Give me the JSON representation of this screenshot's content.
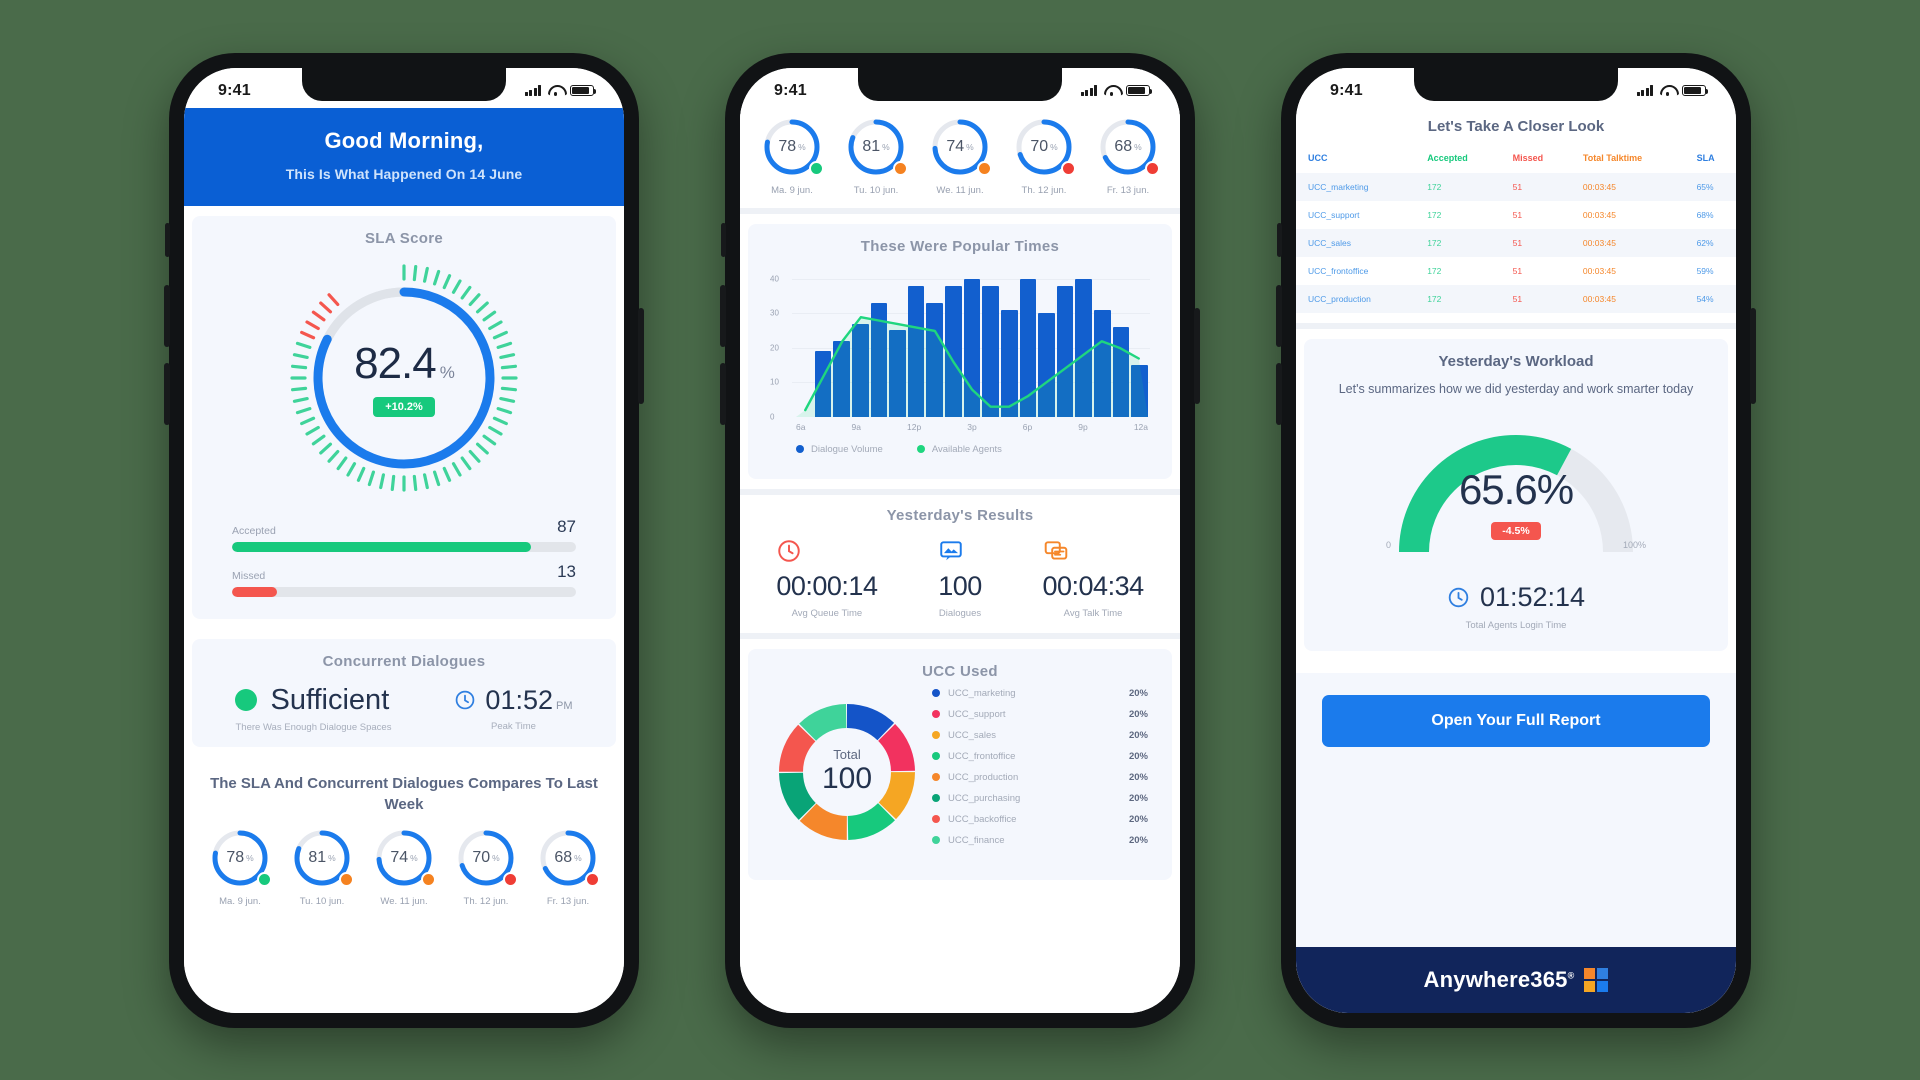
{
  "phone1": {
    "status": {
      "time": "9:41"
    },
    "hero": {
      "title": "Good Morning,",
      "subtitle": "This Is What Happened On 14 June"
    },
    "sla": {
      "title": "SLA Score",
      "value": "82.4",
      "unit": "%",
      "delta": "+10.2%",
      "percent": 82.4
    },
    "bars": [
      {
        "label": "Accepted",
        "value": "87",
        "percent": 87,
        "color": "#17c97d"
      },
      {
        "label": "Missed",
        "value": "13",
        "percent": 13,
        "color": "#f4564e"
      }
    ],
    "concurrent": {
      "title": "Concurrent Dialogues",
      "status": "Sufficient",
      "status_caption": "There Was Enough Dialogue Spaces",
      "peak_time": "01:52",
      "peak_meridiem": "PM",
      "peak_caption": "Peak Time"
    },
    "compare_heading": "The SLA And Concurrent Dialogues Compares To Last Week",
    "days": [
      {
        "value": "78",
        "unit": "%",
        "percent": 78,
        "badge": "#17c97d",
        "label": "Ma. 9 jun."
      },
      {
        "value": "81",
        "unit": "%",
        "percent": 81,
        "badge": "#f58220",
        "label": "Tu. 10 jun."
      },
      {
        "value": "74",
        "unit": "%",
        "percent": 74,
        "badge": "#f58220",
        "label": "We. 11 jun."
      },
      {
        "value": "70",
        "unit": "%",
        "percent": 70,
        "badge": "#ef3d35",
        "label": "Th. 12 jun."
      },
      {
        "value": "68",
        "unit": "%",
        "percent": 68,
        "badge": "#ef3d35",
        "label": "Fr. 13 jun."
      }
    ]
  },
  "phone2": {
    "status": {
      "time": "9:41"
    },
    "days": [
      {
        "value": "78",
        "unit": "%",
        "percent": 78,
        "badge": "#17c97d",
        "label": "Ma. 9 jun."
      },
      {
        "value": "81",
        "unit": "%",
        "percent": 81,
        "badge": "#f58220",
        "label": "Tu. 10 jun."
      },
      {
        "value": "74",
        "unit": "%",
        "percent": 74,
        "badge": "#f58220",
        "label": "We. 11 jun."
      },
      {
        "value": "70",
        "unit": "%",
        "percent": 70,
        "badge": "#ef3d35",
        "label": "Th. 12 jun."
      },
      {
        "value": "68",
        "unit": "%",
        "percent": 68,
        "badge": "#ef3d35",
        "label": "Fr. 13 jun."
      }
    ],
    "popular": {
      "title": "These Were Popular Times"
    },
    "results": {
      "title": "Yesterday's Results",
      "items": [
        {
          "icon": "clock-icon",
          "value": "00:00:14",
          "caption": "Avg Queue Time",
          "color": "#f4564e"
        },
        {
          "icon": "dialogue-icon",
          "value": "100",
          "caption": "Dialogues",
          "color": "#1b7bec"
        },
        {
          "icon": "chat-icon",
          "value": "00:04:34",
          "caption": "Avg Talk Time",
          "color": "#f5872b"
        }
      ]
    },
    "ucc": {
      "title": "UCC Used",
      "total_label": "Total",
      "total_value": "100",
      "items": [
        {
          "name": "UCC_marketing",
          "pct": "20%",
          "color": "#1454c8"
        },
        {
          "name": "UCC_support",
          "pct": "20%",
          "color": "#f2325f"
        },
        {
          "name": "UCC_sales",
          "pct": "20%",
          "color": "#f5a623"
        },
        {
          "name": "UCC_frontoffice",
          "pct": "20%",
          "color": "#17c97d"
        },
        {
          "name": "UCC_production",
          "pct": "20%",
          "color": "#f5872b"
        },
        {
          "name": "UCC_purchasing",
          "pct": "20%",
          "color": "#09a477"
        },
        {
          "name": "UCC_backoffice",
          "pct": "20%",
          "color": "#f4564e"
        },
        {
          "name": "UCC_finance",
          "pct": "20%",
          "color": "#3fd39a"
        }
      ]
    }
  },
  "phone3": {
    "status": {
      "time": "9:41"
    },
    "title": "Let's Take A Closer Look",
    "table": {
      "columns": [
        "UCC",
        "Accepted",
        "Missed",
        "Total Talktime",
        "SLA"
      ],
      "rows": [
        [
          "UCC_marketing",
          "172",
          "51",
          "00:03:45",
          "65%"
        ],
        [
          "UCC_support",
          "172",
          "51",
          "00:03:45",
          "68%"
        ],
        [
          "UCC_sales",
          "172",
          "51",
          "00:03:45",
          "62%"
        ],
        [
          "UCC_frontoffice",
          "172",
          "51",
          "00:03:45",
          "59%"
        ],
        [
          "UCC_production",
          "172",
          "51",
          "00:03:45",
          "54%"
        ]
      ]
    },
    "workload": {
      "title": "Yesterday's Workload",
      "subtitle": "Let's summarizes how we did yesterday and work smarter today",
      "value": "65.6%",
      "percent": 65.6,
      "delta": "-4.5%",
      "min_label": "0",
      "max_label": "100%"
    },
    "login": {
      "value": "01:52:14",
      "caption": "Total Agents Login Time"
    },
    "report_button": "Open Your Full Report",
    "brand": {
      "name": "Anywhere365",
      "trademark": "®"
    }
  },
  "chart_data": {
    "type": "bar",
    "title": "These Were Popular Times",
    "xlabel": "",
    "ylabel": "",
    "ylim": [
      0,
      43
    ],
    "yticks": [
      10,
      20,
      30,
      40
    ],
    "grid": true,
    "legend_position": "bottom-left",
    "tick_labels": [
      "6a",
      "9a",
      "12p",
      "3p",
      "6p",
      "9p",
      "12a"
    ],
    "series": [
      {
        "name": "Dialogue Volume",
        "type": "bar",
        "color": "#125fce",
        "values": [
          0,
          19,
          22,
          27,
          33,
          25,
          38,
          33,
          38,
          40,
          38,
          31,
          40,
          30,
          38,
          40,
          31,
          26,
          15
        ]
      },
      {
        "name": "Available Agents",
        "type": "line",
        "color": "#1fd67f",
        "values": [
          2,
          12,
          22,
          29,
          28,
          27,
          26,
          25,
          16,
          8,
          3,
          3,
          6,
          10,
          14,
          18,
          22,
          20,
          17
        ]
      }
    ]
  },
  "donut_data": {
    "type": "pie",
    "title": "UCC Used",
    "center_label": "Total",
    "center_value": "100",
    "labels": [
      "UCC_marketing",
      "UCC_support",
      "UCC_sales",
      "UCC_frontoffice",
      "UCC_production",
      "UCC_purchasing",
      "UCC_backoffice",
      "UCC_finance"
    ],
    "values": [
      12.5,
      12.5,
      12.5,
      12.5,
      12.5,
      12.5,
      12.5,
      12.5
    ],
    "display_pcts": [
      "20%",
      "20%",
      "20%",
      "20%",
      "20%",
      "20%",
      "20%",
      "20%"
    ],
    "colors": [
      "#1454c8",
      "#f2325f",
      "#f5a623",
      "#17c97d",
      "#f5872b",
      "#09a477",
      "#f4564e",
      "#3fd39a"
    ]
  }
}
